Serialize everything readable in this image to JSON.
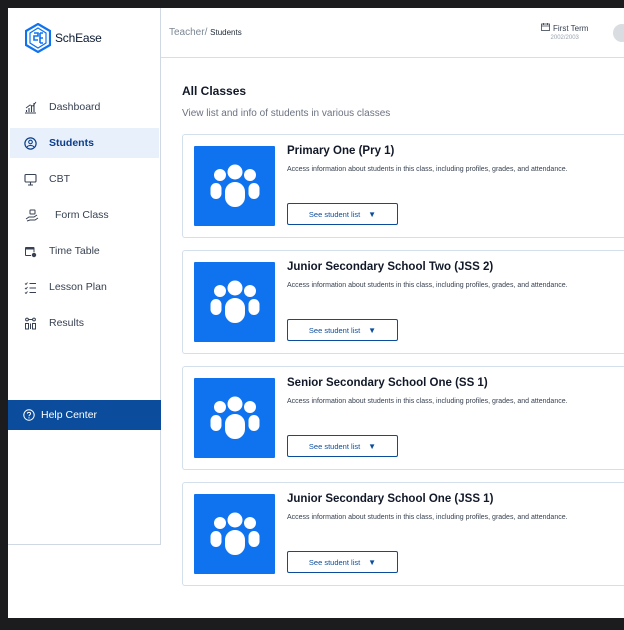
{
  "app": {
    "brand": "SchEase"
  },
  "sidebar": {
    "items": [
      {
        "label": "Dashboard",
        "icon": "chart-bars-icon",
        "active": false
      },
      {
        "label": "Students",
        "icon": "user-circle-icon",
        "active": true
      },
      {
        "label": "CBT",
        "icon": "monitor-icon",
        "active": false
      },
      {
        "label": "Form Class",
        "icon": "hand-icon",
        "active": false
      },
      {
        "label": "Time Table",
        "icon": "calendar-clock-icon",
        "active": false
      },
      {
        "label": "Lesson Plan",
        "icon": "checklist-icon",
        "active": false
      },
      {
        "label": "Results",
        "icon": "results-icon",
        "active": false
      }
    ],
    "help": "Help Center"
  },
  "topbar": {
    "crumb_parent": "Teacher/",
    "crumb_current": "Students",
    "term": "First Term",
    "session": "2002/2003"
  },
  "main": {
    "title": "All Classes",
    "subtitle": "View list and info of students in various classes",
    "cards": [
      {
        "title": "Primary One (Pry 1)",
        "desc": "Access information about students in this class, including profiles, grades, and attendance.",
        "button": "See student list"
      },
      {
        "title": "Junior Secondary School Two (JSS 2)",
        "desc": "Access information about students in this class, including profiles, grades, and attendance.",
        "button": "See student list"
      },
      {
        "title": "Senior Secondary School One (SS 1)",
        "desc": "Access information about students in this class, including profiles, grades, and attendance.",
        "button": "See student list"
      },
      {
        "title": "Junior Secondary School One (JSS 1)",
        "desc": "Access information about students in this class, including profiles, grades, and attendance.",
        "button": "See student list"
      }
    ]
  },
  "colors": {
    "accent": "#0f73f0",
    "navy": "#0b4d9c",
    "active_bg": "#e8f0fb"
  }
}
